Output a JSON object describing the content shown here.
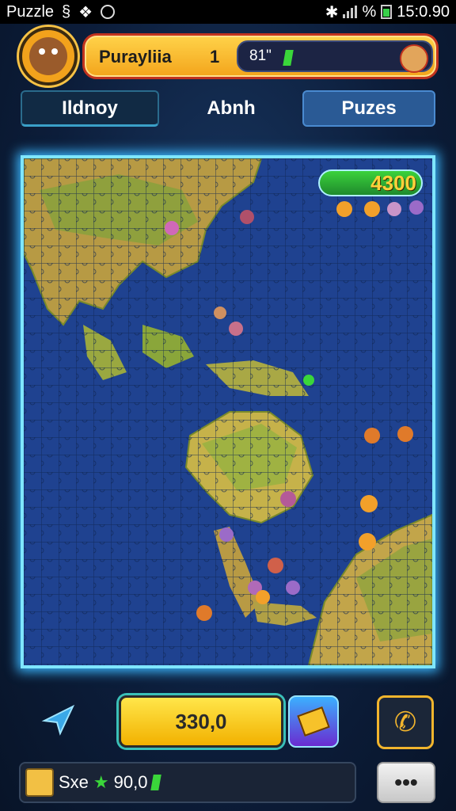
{
  "status_bar": {
    "app_label": "Puzzle",
    "right_text": "%",
    "clock": "15:0.90"
  },
  "header": {
    "player_name": "Purayliia",
    "level": "1",
    "gem_count": "81\"",
    "gem_color": "#3ad63a"
  },
  "tabs": [
    {
      "label": "Ildnoy"
    },
    {
      "label": "Abnh"
    },
    {
      "label": "Puzes"
    }
  ],
  "board": {
    "score": "4300",
    "frame_color": "#7fe6ff",
    "ocean_color": "#1e3f86",
    "land_color": "#c6b24a"
  },
  "bottom": {
    "main_button_label": "330,0",
    "card_icon": "card-icon",
    "phone_icon": "phone-icon",
    "kite_icon": "kite-icon",
    "footer_name": "Sxe",
    "footer_points": "90,0",
    "more_label": "•••"
  }
}
